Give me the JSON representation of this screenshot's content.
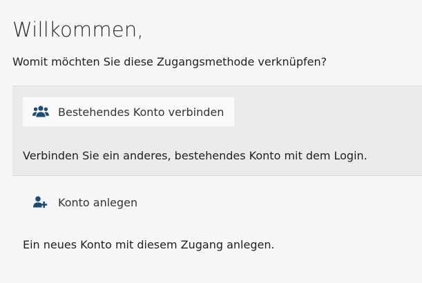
{
  "heading": "Willkommen,",
  "question": "Womit möchten Sie diese Zugangsmethode verknüpfen?",
  "options": [
    {
      "label": "Bestehendes Konto verbinden",
      "icon": "users-icon",
      "description": "Verbinden Sie ein anderes, bestehendes Konto mit dem Login.",
      "selected": true
    },
    {
      "label": "Konto anlegen",
      "icon": "user-plus-icon",
      "description": "Ein neues Konto mit diesem Zugang anlegen.",
      "selected": false
    }
  ],
  "colors": {
    "icon": "#1d4b73",
    "selected_background": "#ebebeb",
    "page_background": "#f7f7f7"
  }
}
